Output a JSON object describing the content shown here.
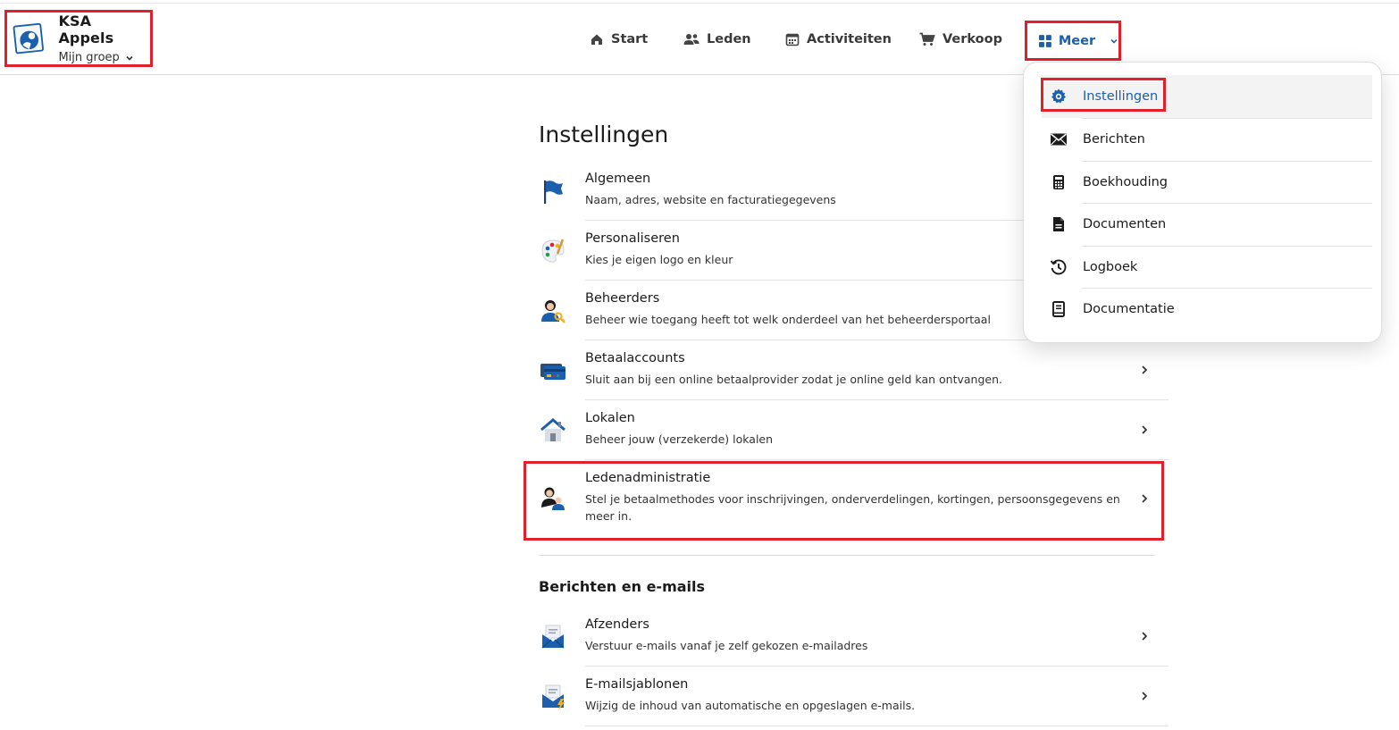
{
  "org": {
    "name": "KSA Appels",
    "subtitle": "Mijn groep"
  },
  "nav": {
    "items": [
      {
        "label": "Start",
        "icon": "home-icon"
      },
      {
        "label": "Leden",
        "icon": "users-icon"
      },
      {
        "label": "Activiteiten",
        "icon": "calendar-icon"
      },
      {
        "label": "Verkoop",
        "icon": "cart-icon"
      }
    ],
    "more": {
      "label": "Meer",
      "icon": "grid-icon"
    }
  },
  "dropdown": {
    "items": [
      {
        "label": "Instellingen",
        "icon": "gear-icon",
        "active": true
      },
      {
        "label": "Berichten",
        "icon": "envelope-icon"
      },
      {
        "label": "Boekhouding",
        "icon": "calculator-icon"
      },
      {
        "label": "Documenten",
        "icon": "document-icon"
      },
      {
        "label": "Logboek",
        "icon": "history-icon"
      },
      {
        "label": "Documentatie",
        "icon": "book-icon"
      }
    ]
  },
  "page": {
    "title": "Instellingen",
    "settings": [
      {
        "title": "Algemeen",
        "desc": "Naam, adres, website en facturatiegegevens",
        "icon": "flag-icon"
      },
      {
        "title": "Personaliseren",
        "desc": "Kies je eigen logo en kleur",
        "icon": "palette-icon"
      },
      {
        "title": "Beheerders",
        "desc": "Beheer wie toegang heeft tot welk onderdeel van het beheerdersportaal",
        "icon": "admin-key-icon"
      },
      {
        "title": "Betaalaccounts",
        "desc": "Sluit aan bij een online betaalprovider zodat je online geld kan ontvangen.",
        "icon": "credit-card-icon"
      },
      {
        "title": "Lokalen",
        "desc": "Beheer jouw (verzekerde) lokalen",
        "icon": "house-icon"
      },
      {
        "title": "Ledenadministratie",
        "desc": "Stel je betaalmethodes voor inschrijvingen, onderverdelingen, kortingen, persoonsgegevens en meer in.",
        "icon": "members-icon"
      }
    ],
    "section_title": "Berichten en e-mails",
    "messages": [
      {
        "title": "Afzenders",
        "desc": "Verstuur e-mails vanaf je zelf gekozen e-mailadres",
        "icon": "mail-sender-icon"
      },
      {
        "title": "E-mailsjablonen",
        "desc": "Wijzig de inhoud van automatische en opgeslagen e-mails.",
        "icon": "mail-template-icon"
      }
    ]
  },
  "colors": {
    "accent": "#1b5fad",
    "highlight": "#e0202a"
  }
}
